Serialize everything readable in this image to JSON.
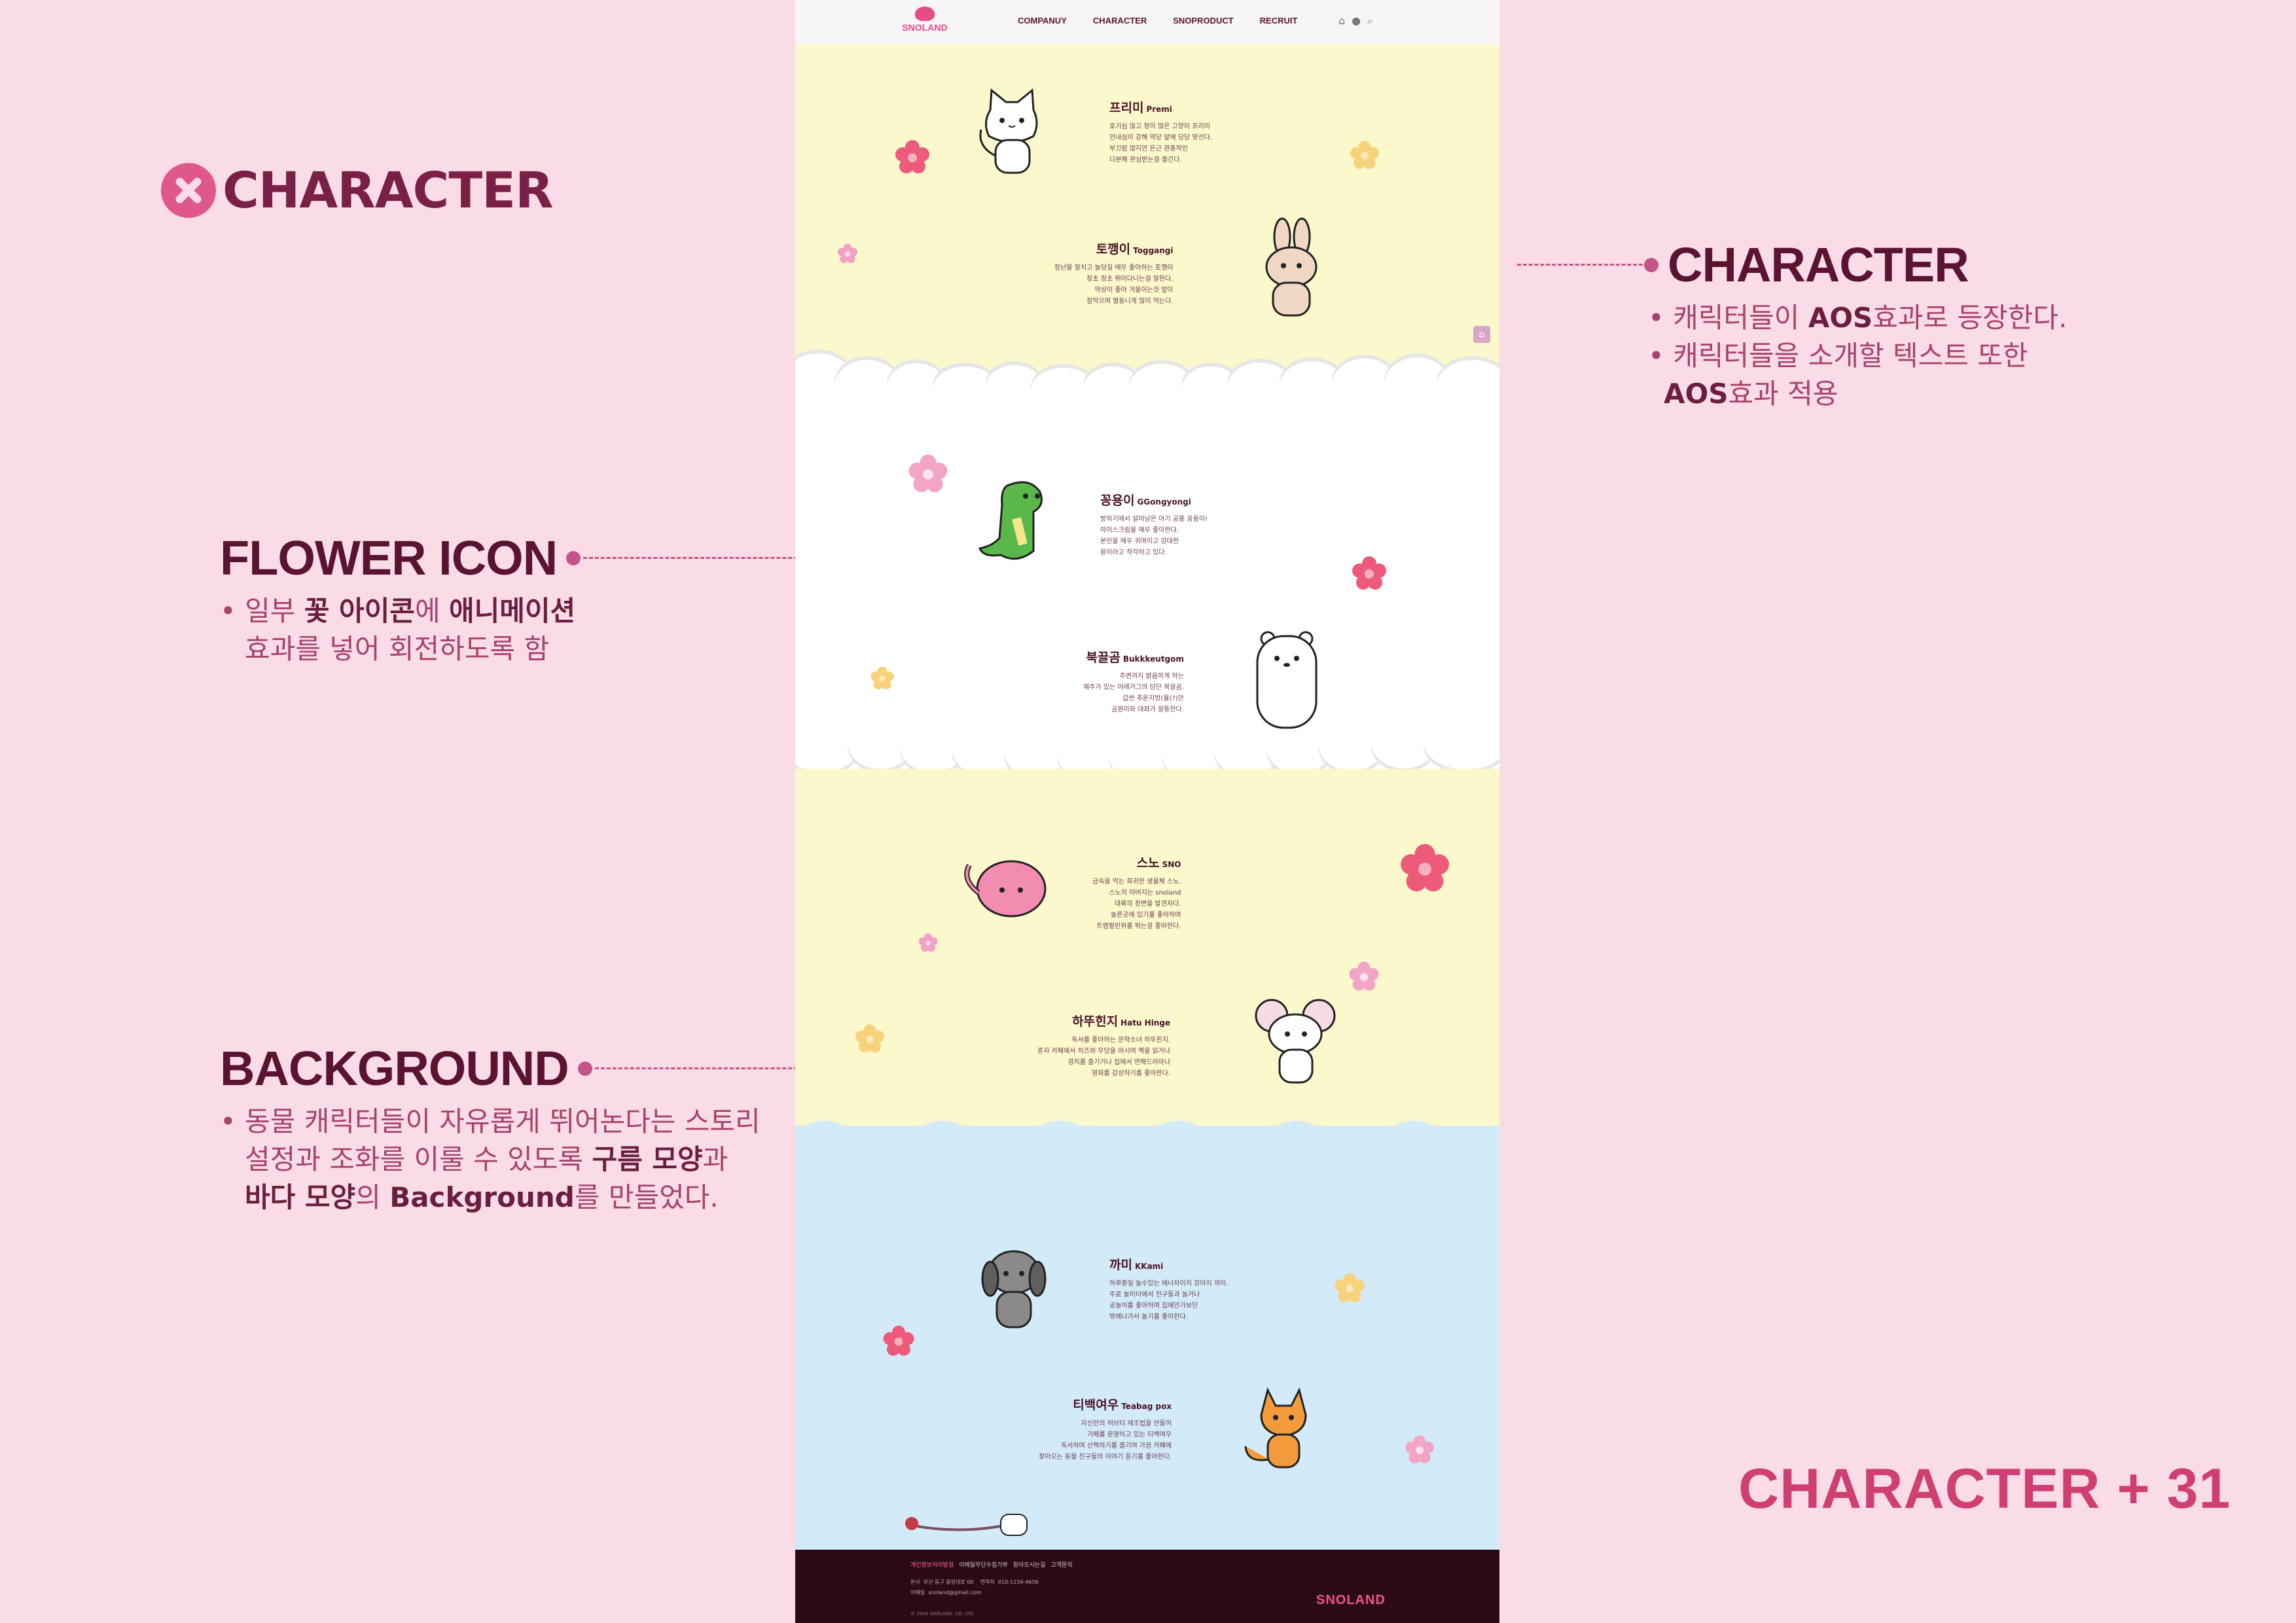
{
  "heading": {
    "title": "CHARACTER"
  },
  "notes": {
    "character": {
      "title": "CHARACTER",
      "lines": [
        [
          "• 캐릭터들이 ",
          "AOS",
          "효과로 등장한다."
        ],
        [
          "• 캐릭터들을 소개할 텍스트 또한"
        ],
        [
          "AOS",
          "효과 적용"
        ]
      ]
    },
    "flower": {
      "title": "FLOWER ICON",
      "lines": [
        [
          "• 일부 ",
          "꽃 아이콘",
          "에 ",
          "애니메이션"
        ],
        [
          "효과를 넣어 회전하도록 함"
        ]
      ]
    },
    "background": {
      "title": "BACKGROUND",
      "lines": [
        [
          "• 동물 캐릭터들이 자유롭게 뛰어논다는 스토리"
        ],
        [
          "설정과 조화를 이룰 수 있도록 ",
          "구름 모양",
          "과"
        ],
        [
          "바다 모양",
          "의 ",
          "Background",
          "를 만들었다."
        ]
      ]
    }
  },
  "tag": "CHARACTER  +  31",
  "site": {
    "logo": "SNOLAND",
    "nav": [
      "COMPANUY",
      "CHARACTER",
      "SNOPRODUCT",
      "RECRUIT"
    ],
    "icons": [
      "home-icon",
      "user-icon",
      "search-icon"
    ],
    "top_button": "⌂"
  },
  "characters": [
    {
      "ko": "프리미",
      "en": "Premi",
      "desc": [
        "호기심 많고 정이 많은 고양이 프리미",
        "인내심이 강해 악당 앞에 당당 맞선다.",
        "부끄럼 많지만 은근 관종적인",
        "다분해 관심받는걸 즐긴다."
      ]
    },
    {
      "ko": "토깽이",
      "en": "Toggangi",
      "desc": [
        "장난을 잘치고 놀당길 매우 좋아하는 토깽이",
        "장초 장초 뛰어다니는걸 잘한다.",
        "막상이 좋아 겨을이는것 앞이",
        "잠막으며 별동니게 많이 먹는다."
      ]
    },
    {
      "ko": "꽁용이",
      "en": "GGongyongi",
      "desc": [
        "방하기에서 살아남은 아기 공룡 꽁용이!",
        "아이스크림을 매우 좋아한다.",
        "본인을 매우 귀여이고 강대한",
        "용이라고 착각하고 있다."
      ]
    },
    {
      "ko": "북끌곰",
      "en": "Bukkkeutgom",
      "desc": [
        "주변까지 밝음하게 하는",
        "재주가 있는 아래거그의 당단 북끌곰.",
        "갑싼 추운지방(율(?)만",
        "곰원이와 대화가 잘통한다."
      ]
    },
    {
      "ko": "스노",
      "en": "SNO",
      "desc": [
        "금속을 먹는 희귀한 생물체 스노.",
        "스노의 아버지는 snoland",
        "대륙의 창변을 발견자다.",
        "놀른곳에 있기를 좋아하며",
        "트램펄린위를 뛰는걸 좋아한다."
      ]
    },
    {
      "ko": "하뚜힌지",
      "en": "Hatu Hinge",
      "desc": [
        "독서를 좋아하는 문학소녀 하뚜힌지.",
        "혼자 카페에서 치즈와 무당을 마시며 책을 읽거나",
        "경치를 즐기거나 집에서 연해드라마나",
        "영화를 감상하기를 좋아한다."
      ]
    },
    {
      "ko": "까미",
      "en": "KKami",
      "desc": [
        "하루종일 놀수있는 에너자이저 강아지 까미.",
        "주로 놀이터에서 친구들과 놀거나",
        "공놀이를 좋아하며 집에만가보단",
        "밖에나가서 놀기를 좋아한다."
      ]
    },
    {
      "ko": "티백여우",
      "en": "Teabag pox",
      "desc": [
        "자신만의 허브티 제조법을 만들어",
        "가페를 운영하고 있는 티백여우",
        "독서하며 산책하기를 즐기며 가끔 카페에",
        "찾아오는 동물 친구들의 이야기 듣기를 좋아한다."
      ]
    }
  ],
  "footer": {
    "links": [
      "개인정보처리방침",
      "이메일무단수집거부",
      "찾아오시는길",
      "고객문의"
    ],
    "address_label": "본사",
    "address": "부산 동구 중앙대로 00",
    "phone_label": "연락처",
    "phone": "010-1234-4656",
    "email_label": "이메일",
    "email": "snoland@gmail.com",
    "copyright": "© 2024 SNOLAND. CO. LTD.",
    "logo": "SNOLAND"
  },
  "colors": {
    "page_bg": "#f9dce6",
    "accent": "#cf3f74",
    "heading": "#5b1333",
    "yellow_band": "#fbf8cc",
    "blue_band": "#d3ebf8",
    "footer_bg": "#2b0a17"
  }
}
